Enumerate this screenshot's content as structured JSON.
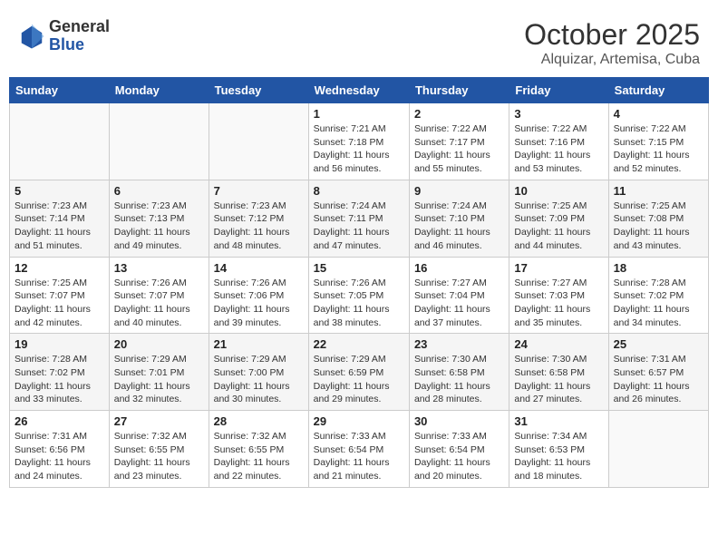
{
  "header": {
    "logo_general": "General",
    "logo_blue": "Blue",
    "month": "October 2025",
    "location": "Alquizar, Artemisa, Cuba"
  },
  "weekdays": [
    "Sunday",
    "Monday",
    "Tuesday",
    "Wednesday",
    "Thursday",
    "Friday",
    "Saturday"
  ],
  "weeks": [
    [
      {
        "day": "",
        "info": ""
      },
      {
        "day": "",
        "info": ""
      },
      {
        "day": "",
        "info": ""
      },
      {
        "day": "1",
        "info": "Sunrise: 7:21 AM\nSunset: 7:18 PM\nDaylight: 11 hours and 56 minutes."
      },
      {
        "day": "2",
        "info": "Sunrise: 7:22 AM\nSunset: 7:17 PM\nDaylight: 11 hours and 55 minutes."
      },
      {
        "day": "3",
        "info": "Sunrise: 7:22 AM\nSunset: 7:16 PM\nDaylight: 11 hours and 53 minutes."
      },
      {
        "day": "4",
        "info": "Sunrise: 7:22 AM\nSunset: 7:15 PM\nDaylight: 11 hours and 52 minutes."
      }
    ],
    [
      {
        "day": "5",
        "info": "Sunrise: 7:23 AM\nSunset: 7:14 PM\nDaylight: 11 hours and 51 minutes."
      },
      {
        "day": "6",
        "info": "Sunrise: 7:23 AM\nSunset: 7:13 PM\nDaylight: 11 hours and 49 minutes."
      },
      {
        "day": "7",
        "info": "Sunrise: 7:23 AM\nSunset: 7:12 PM\nDaylight: 11 hours and 48 minutes."
      },
      {
        "day": "8",
        "info": "Sunrise: 7:24 AM\nSunset: 7:11 PM\nDaylight: 11 hours and 47 minutes."
      },
      {
        "day": "9",
        "info": "Sunrise: 7:24 AM\nSunset: 7:10 PM\nDaylight: 11 hours and 46 minutes."
      },
      {
        "day": "10",
        "info": "Sunrise: 7:25 AM\nSunset: 7:09 PM\nDaylight: 11 hours and 44 minutes."
      },
      {
        "day": "11",
        "info": "Sunrise: 7:25 AM\nSunset: 7:08 PM\nDaylight: 11 hours and 43 minutes."
      }
    ],
    [
      {
        "day": "12",
        "info": "Sunrise: 7:25 AM\nSunset: 7:07 PM\nDaylight: 11 hours and 42 minutes."
      },
      {
        "day": "13",
        "info": "Sunrise: 7:26 AM\nSunset: 7:07 PM\nDaylight: 11 hours and 40 minutes."
      },
      {
        "day": "14",
        "info": "Sunrise: 7:26 AM\nSunset: 7:06 PM\nDaylight: 11 hours and 39 minutes."
      },
      {
        "day": "15",
        "info": "Sunrise: 7:26 AM\nSunset: 7:05 PM\nDaylight: 11 hours and 38 minutes."
      },
      {
        "day": "16",
        "info": "Sunrise: 7:27 AM\nSunset: 7:04 PM\nDaylight: 11 hours and 37 minutes."
      },
      {
        "day": "17",
        "info": "Sunrise: 7:27 AM\nSunset: 7:03 PM\nDaylight: 11 hours and 35 minutes."
      },
      {
        "day": "18",
        "info": "Sunrise: 7:28 AM\nSunset: 7:02 PM\nDaylight: 11 hours and 34 minutes."
      }
    ],
    [
      {
        "day": "19",
        "info": "Sunrise: 7:28 AM\nSunset: 7:02 PM\nDaylight: 11 hours and 33 minutes."
      },
      {
        "day": "20",
        "info": "Sunrise: 7:29 AM\nSunset: 7:01 PM\nDaylight: 11 hours and 32 minutes."
      },
      {
        "day": "21",
        "info": "Sunrise: 7:29 AM\nSunset: 7:00 PM\nDaylight: 11 hours and 30 minutes."
      },
      {
        "day": "22",
        "info": "Sunrise: 7:29 AM\nSunset: 6:59 PM\nDaylight: 11 hours and 29 minutes."
      },
      {
        "day": "23",
        "info": "Sunrise: 7:30 AM\nSunset: 6:58 PM\nDaylight: 11 hours and 28 minutes."
      },
      {
        "day": "24",
        "info": "Sunrise: 7:30 AM\nSunset: 6:58 PM\nDaylight: 11 hours and 27 minutes."
      },
      {
        "day": "25",
        "info": "Sunrise: 7:31 AM\nSunset: 6:57 PM\nDaylight: 11 hours and 26 minutes."
      }
    ],
    [
      {
        "day": "26",
        "info": "Sunrise: 7:31 AM\nSunset: 6:56 PM\nDaylight: 11 hours and 24 minutes."
      },
      {
        "day": "27",
        "info": "Sunrise: 7:32 AM\nSunset: 6:55 PM\nDaylight: 11 hours and 23 minutes."
      },
      {
        "day": "28",
        "info": "Sunrise: 7:32 AM\nSunset: 6:55 PM\nDaylight: 11 hours and 22 minutes."
      },
      {
        "day": "29",
        "info": "Sunrise: 7:33 AM\nSunset: 6:54 PM\nDaylight: 11 hours and 21 minutes."
      },
      {
        "day": "30",
        "info": "Sunrise: 7:33 AM\nSunset: 6:54 PM\nDaylight: 11 hours and 20 minutes."
      },
      {
        "day": "31",
        "info": "Sunrise: 7:34 AM\nSunset: 6:53 PM\nDaylight: 11 hours and 18 minutes."
      },
      {
        "day": "",
        "info": ""
      }
    ]
  ]
}
